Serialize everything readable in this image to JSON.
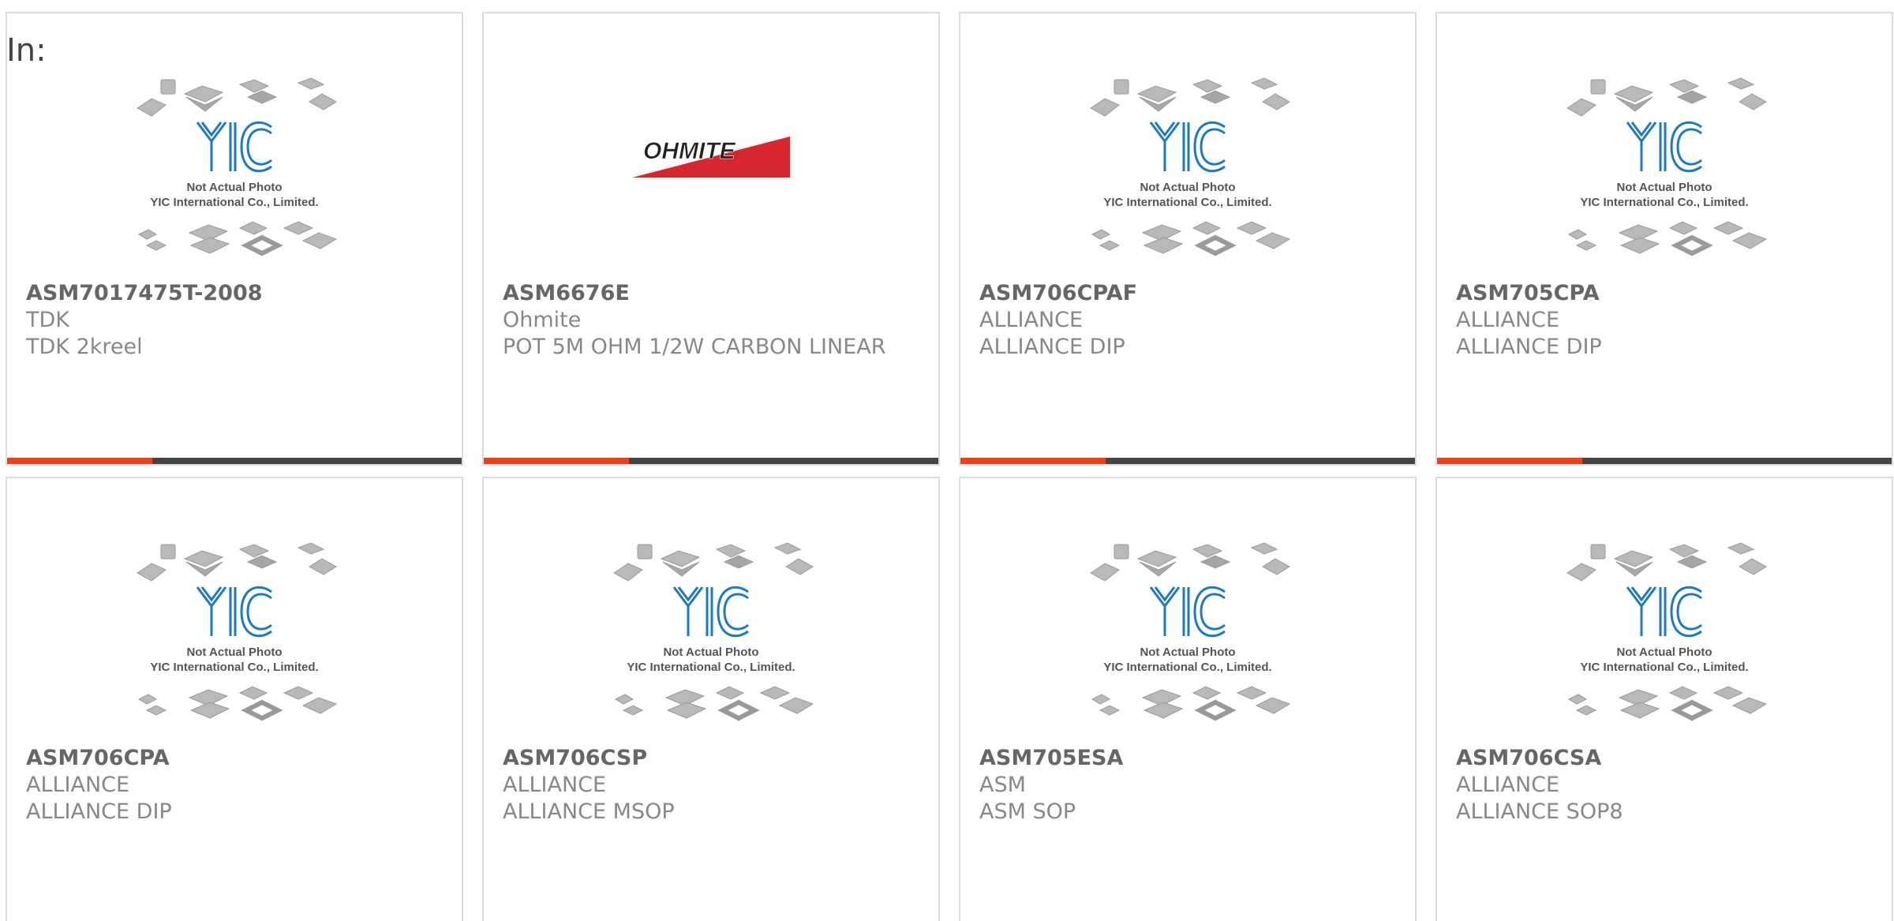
{
  "header": {
    "label": "In:"
  },
  "colors": {
    "accent": "#e8431b",
    "bar_dark": "#444444",
    "border": "#dddddd"
  },
  "placeholder": {
    "brand": "YIC",
    "line1": "Not Actual Photo",
    "line2": "YIC International Co., Limited."
  },
  "products": [
    {
      "part": "ASM7017475T-2008",
      "maker": "TDK",
      "desc": "TDK 2kreel",
      "image": "not-actual-photo-placeholder"
    },
    {
      "part": "ASM6676E",
      "maker": "Ohmite",
      "desc": "POT 5M OHM 1/2W CARBON LINEAR",
      "image": "ohmite-logo",
      "logo_text": "OHMITE"
    },
    {
      "part": "ASM706CPAF",
      "maker": "ALLIANCE",
      "desc": "ALLIANCE DIP",
      "image": "not-actual-photo-placeholder"
    },
    {
      "part": "ASM705CPA",
      "maker": "ALLIANCE",
      "desc": "ALLIANCE DIP",
      "image": "not-actual-photo-placeholder"
    },
    {
      "part": "ASM706CPA",
      "maker": "ALLIANCE",
      "desc": "ALLIANCE DIP",
      "image": "not-actual-photo-placeholder"
    },
    {
      "part": "ASM706CSP",
      "maker": "ALLIANCE",
      "desc": "ALLIANCE MSOP",
      "image": "not-actual-photo-placeholder"
    },
    {
      "part": "ASM705ESA",
      "maker": "ASM",
      "desc": "ASM SOP",
      "image": "not-actual-photo-placeholder"
    },
    {
      "part": "ASM706CSA",
      "maker": "ALLIANCE",
      "desc": "ALLIANCE SOP8",
      "image": "not-actual-photo-placeholder"
    }
  ]
}
